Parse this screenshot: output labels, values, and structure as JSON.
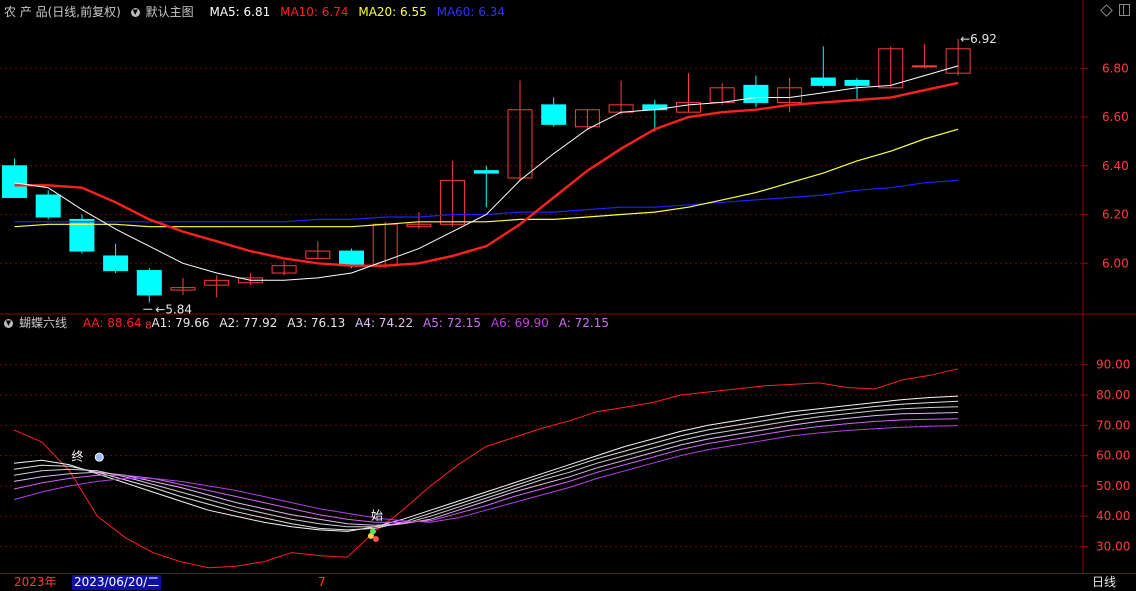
{
  "header": {
    "title": "农 产 品(日线,前复权)",
    "main_label": "默认主图",
    "ma5": "MA5: 6.81",
    "ma10": "MA10: 6.74",
    "ma20": "MA20: 6.55",
    "ma60": "MA60: 6.34"
  },
  "sub_header": {
    "title": "蝴蝶六线",
    "aa": "AA: 88.64",
    "a1": "A1: 79.66",
    "a2": "A2: 77.92",
    "a3": "A3: 76.13",
    "a4": "A4: 74.22",
    "a5": "A5: 72.15",
    "a6": "A6: 69.90",
    "a": "A: 72.15"
  },
  "bottom": {
    "year": "2023年",
    "date": "2023/06/20/二",
    "month": "7",
    "period": "日线"
  },
  "colors": {
    "up": "#ff3b3b",
    "down": "#00ffff",
    "ma5": "#ffffff",
    "ma10": "#ff2020",
    "ma20": "#ffff40",
    "ma60": "#2020ff",
    "axis": "#8a0a0a",
    "aa": "#ff2020"
  },
  "chart_data": [
    {
      "type": "candlestick",
      "yticks": [
        "6.00",
        "6.20",
        "6.40",
        "6.60",
        "6.80"
      ],
      "ylim": [
        5.8,
        6.99
      ],
      "annotations": {
        "low": "5.84",
        "high": "6.92",
        "marker": "8"
      },
      "candles": [
        {
          "o": 6.4,
          "h": 6.43,
          "l": 6.27,
          "c": 6.27
        },
        {
          "o": 6.28,
          "h": 6.3,
          "l": 6.18,
          "c": 6.19
        },
        {
          "o": 6.18,
          "h": 6.2,
          "l": 6.04,
          "c": 6.05
        },
        {
          "o": 6.03,
          "h": 6.08,
          "l": 5.96,
          "c": 5.97
        },
        {
          "o": 5.97,
          "h": 5.98,
          "l": 5.84,
          "c": 5.87
        },
        {
          "o": 5.89,
          "h": 5.94,
          "l": 5.87,
          "c": 5.9
        },
        {
          "o": 5.91,
          "h": 5.95,
          "l": 5.86,
          "c": 5.93
        },
        {
          "o": 5.92,
          "h": 5.96,
          "l": 5.91,
          "c": 5.94
        },
        {
          "o": 5.96,
          "h": 6.01,
          "l": 5.95,
          "c": 5.99
        },
        {
          "o": 6.02,
          "h": 6.09,
          "l": 6.02,
          "c": 6.05
        },
        {
          "o": 6.05,
          "h": 6.06,
          "l": 5.98,
          "c": 5.99
        },
        {
          "o": 5.99,
          "h": 6.17,
          "l": 5.98,
          "c": 6.16
        },
        {
          "o": 6.15,
          "h": 6.21,
          "l": 6.14,
          "c": 6.16
        },
        {
          "o": 6.16,
          "h": 6.42,
          "l": 6.15,
          "c": 6.34
        },
        {
          "o": 6.38,
          "h": 6.4,
          "l": 6.23,
          "c": 6.37
        },
        {
          "o": 6.35,
          "h": 6.75,
          "l": 6.34,
          "c": 6.63
        },
        {
          "o": 6.65,
          "h": 6.68,
          "l": 6.56,
          "c": 6.57
        },
        {
          "o": 6.56,
          "h": 6.63,
          "l": 6.55,
          "c": 6.63
        },
        {
          "o": 6.62,
          "h": 6.75,
          "l": 6.61,
          "c": 6.65
        },
        {
          "o": 6.65,
          "h": 6.67,
          "l": 6.54,
          "c": 6.63
        },
        {
          "o": 6.62,
          "h": 6.78,
          "l": 6.62,
          "c": 6.66
        },
        {
          "o": 6.66,
          "h": 6.74,
          "l": 6.65,
          "c": 6.72
        },
        {
          "o": 6.73,
          "h": 6.77,
          "l": 6.64,
          "c": 6.66
        },
        {
          "o": 6.66,
          "h": 6.76,
          "l": 6.62,
          "c": 6.72
        },
        {
          "o": 6.76,
          "h": 6.89,
          "l": 6.72,
          "c": 6.73
        },
        {
          "o": 6.75,
          "h": 6.76,
          "l": 6.67,
          "c": 6.73
        },
        {
          "o": 6.72,
          "h": 6.89,
          "l": 6.72,
          "c": 6.88
        },
        {
          "o": 6.81,
          "h": 6.9,
          "l": 6.8,
          "c": 6.81
        },
        {
          "o": 6.78,
          "h": 6.92,
          "l": 6.77,
          "c": 6.88
        }
      ],
      "ma5": [
        6.33,
        6.31,
        6.22,
        6.14,
        6.07,
        6.0,
        5.96,
        5.93,
        5.93,
        5.94,
        5.96,
        6.01,
        6.06,
        6.13,
        6.2,
        6.34,
        6.45,
        6.55,
        6.62,
        6.63,
        6.65,
        6.66,
        6.68,
        6.68,
        6.7,
        6.72,
        6.73,
        6.77,
        6.81
      ],
      "ma10": [
        6.32,
        6.32,
        6.31,
        6.25,
        6.18,
        6.13,
        6.09,
        6.05,
        6.02,
        6.0,
        5.99,
        5.99,
        6.0,
        6.03,
        6.07,
        6.16,
        6.27,
        6.38,
        6.47,
        6.55,
        6.6,
        6.62,
        6.63,
        6.65,
        6.66,
        6.67,
        6.68,
        6.71,
        6.74
      ],
      "ma20": [
        6.15,
        6.16,
        6.16,
        6.16,
        6.15,
        6.15,
        6.15,
        6.15,
        6.15,
        6.15,
        6.15,
        6.16,
        6.17,
        6.17,
        6.17,
        6.18,
        6.18,
        6.19,
        6.2,
        6.21,
        6.23,
        6.26,
        6.29,
        6.33,
        6.37,
        6.42,
        6.46,
        6.51,
        6.55
      ],
      "ma60": [
        6.17,
        6.17,
        6.17,
        6.17,
        6.17,
        6.17,
        6.17,
        6.17,
        6.17,
        6.18,
        6.18,
        6.19,
        6.19,
        6.2,
        6.2,
        6.21,
        6.21,
        6.22,
        6.23,
        6.23,
        6.24,
        6.25,
        6.26,
        6.27,
        6.28,
        6.3,
        6.31,
        6.33,
        6.34
      ]
    },
    {
      "type": "line",
      "yticks": [
        "30.00",
        "40.00",
        "50.00",
        "60.00",
        "70.00",
        "80.00",
        "90.00"
      ],
      "ylim": [
        21.6,
        100.8
      ],
      "annotations": {
        "marker_top": "终",
        "marker_bottom": "始"
      },
      "series": [
        {
          "name": "AA",
          "values": [
            68.5,
            64.5,
            55.0,
            40.0,
            33.0,
            28.0,
            25.0,
            23.0,
            23.5,
            25.0,
            28.0,
            27.0,
            26.5,
            35.0,
            42.0,
            50.0,
            57.0,
            63.0,
            66.0,
            69.0,
            71.5,
            74.5,
            76.0,
            77.5,
            80.0,
            81.0,
            82.0,
            83.0,
            83.5,
            84.0,
            82.5,
            82.0,
            85.0,
            86.5,
            88.64
          ]
        },
        {
          "name": "A1",
          "values": [
            57.5,
            58.5,
            57.0,
            54.0,
            51.0,
            48.0,
            45.0,
            42.0,
            40.0,
            38.0,
            36.5,
            35.5,
            35.0,
            36.5,
            39.0,
            42.0,
            45.0,
            48.0,
            51.0,
            54.0,
            57.0,
            60.0,
            63.0,
            65.5,
            68.0,
            70.0,
            71.5,
            73.0,
            74.5,
            75.5,
            76.5,
            77.5,
            78.5,
            79.2,
            79.66
          ]
        },
        {
          "name": "A2",
          "values": [
            55.5,
            56.8,
            56.5,
            54.5,
            52.0,
            49.5,
            46.5,
            44.0,
            41.5,
            39.5,
            37.5,
            36.0,
            35.5,
            36.0,
            38.0,
            41.0,
            44.0,
            47.0,
            50.0,
            53.0,
            56.0,
            59.0,
            61.5,
            64.0,
            66.5,
            68.5,
            70.0,
            71.5,
            73.0,
            74.2,
            75.2,
            76.2,
            77.0,
            77.5,
            77.92
          ]
        },
        {
          "name": "A3",
          "values": [
            53.5,
            55.0,
            55.5,
            55.0,
            53.0,
            50.5,
            48.0,
            45.5,
            43.0,
            41.0,
            39.0,
            37.5,
            36.5,
            36.5,
            37.5,
            40.0,
            43.0,
            46.0,
            49.0,
            52.0,
            54.5,
            57.5,
            60.0,
            62.5,
            65.0,
            67.0,
            68.5,
            70.0,
            71.5,
            72.8,
            73.8,
            74.8,
            75.5,
            75.9,
            76.13
          ]
        },
        {
          "name": "A4",
          "values": [
            51.5,
            53.0,
            54.0,
            54.5,
            53.5,
            51.5,
            49.5,
            47.0,
            44.5,
            42.5,
            40.5,
            39.0,
            37.5,
            37.0,
            37.5,
            39.0,
            42.0,
            45.0,
            48.0,
            50.5,
            53.0,
            56.0,
            58.5,
            61.0,
            63.5,
            65.5,
            67.0,
            68.5,
            70.0,
            71.3,
            72.3,
            73.2,
            73.8,
            74.0,
            74.22
          ]
        },
        {
          "name": "A5",
          "values": [
            49.0,
            51.0,
            52.5,
            53.5,
            53.5,
            52.5,
            50.5,
            48.5,
            46.5,
            44.5,
            42.5,
            40.5,
            39.0,
            38.0,
            38.0,
            38.5,
            41.0,
            43.5,
            46.5,
            49.0,
            51.5,
            54.5,
            57.0,
            59.5,
            62.0,
            64.0,
            65.5,
            67.0,
            68.5,
            69.6,
            70.5,
            71.3,
            71.8,
            72.0,
            72.15
          ]
        },
        {
          "name": "A6",
          "values": [
            45.5,
            48.0,
            50.0,
            51.5,
            52.5,
            52.5,
            51.5,
            50.0,
            48.5,
            46.5,
            44.5,
            42.5,
            41.0,
            39.5,
            38.5,
            38.0,
            39.5,
            42.0,
            44.5,
            47.0,
            49.5,
            52.5,
            55.0,
            57.5,
            60.0,
            62.0,
            63.5,
            65.0,
            66.5,
            67.5,
            68.3,
            68.9,
            69.4,
            69.7,
            69.9
          ]
        }
      ]
    }
  ]
}
